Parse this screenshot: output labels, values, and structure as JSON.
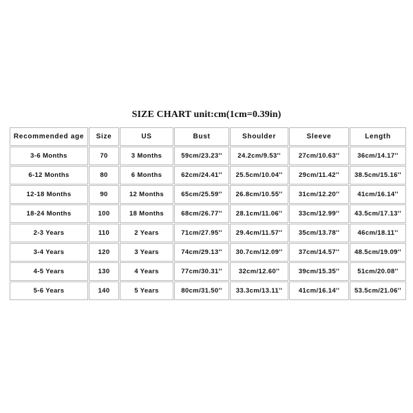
{
  "title": "SIZE CHART unit:cm(1cm=0.39in)",
  "chart_data": {
    "type": "table",
    "title": "SIZE CHART unit:cm(1cm=0.39in)",
    "columns": [
      "Recommended age",
      "Size",
      "US",
      "Bust",
      "Shoulder",
      "Sleeve",
      "Length"
    ],
    "rows": [
      {
        "recommended_age": "3-6 Months",
        "size": "70",
        "us": "3 Months",
        "bust": "59cm/23.23''",
        "shoulder": "24.2cm/9.53''",
        "sleeve": "27cm/10.63''",
        "length": "36cm/14.17''"
      },
      {
        "recommended_age": "6-12 Months",
        "size": "80",
        "us": "6 Months",
        "bust": "62cm/24.41''",
        "shoulder": "25.5cm/10.04''",
        "sleeve": "29cm/11.42''",
        "length": "38.5cm/15.16''"
      },
      {
        "recommended_age": "12-18 Months",
        "size": "90",
        "us": "12 Months",
        "bust": "65cm/25.59''",
        "shoulder": "26.8cm/10.55''",
        "sleeve": "31cm/12.20''",
        "length": "41cm/16.14''"
      },
      {
        "recommended_age": "18-24 Months",
        "size": "100",
        "us": "18 Months",
        "bust": "68cm/26.77''",
        "shoulder": "28.1cm/11.06''",
        "sleeve": "33cm/12.99''",
        "length": "43.5cm/17.13''"
      },
      {
        "recommended_age": "2-3 Years",
        "size": "110",
        "us": "2 Years",
        "bust": "71cm/27.95''",
        "shoulder": "29.4cm/11.57''",
        "sleeve": "35cm/13.78''",
        "length": "46cm/18.11''"
      },
      {
        "recommended_age": "3-4 Years",
        "size": "120",
        "us": "3 Years",
        "bust": "74cm/29.13''",
        "shoulder": "30.7cm/12.09''",
        "sleeve": "37cm/14.57''",
        "length": "48.5cm/19.09''"
      },
      {
        "recommended_age": "4-5 Years",
        "size": "130",
        "us": "4 Years",
        "bust": "77cm/30.31''",
        "shoulder": "32cm/12.60''",
        "sleeve": "39cm/15.35''",
        "length": "51cm/20.08''"
      },
      {
        "recommended_age": "5-6 Years",
        "size": "140",
        "us": "5 Years",
        "bust": "80cm/31.50''",
        "shoulder": "33.3cm/13.11''",
        "sleeve": "41cm/16.14''",
        "length": "53.5cm/21.06''"
      }
    ]
  },
  "colors": {
    "background": "#ffffff",
    "text": "#111111",
    "border": "#b9b9b9"
  }
}
